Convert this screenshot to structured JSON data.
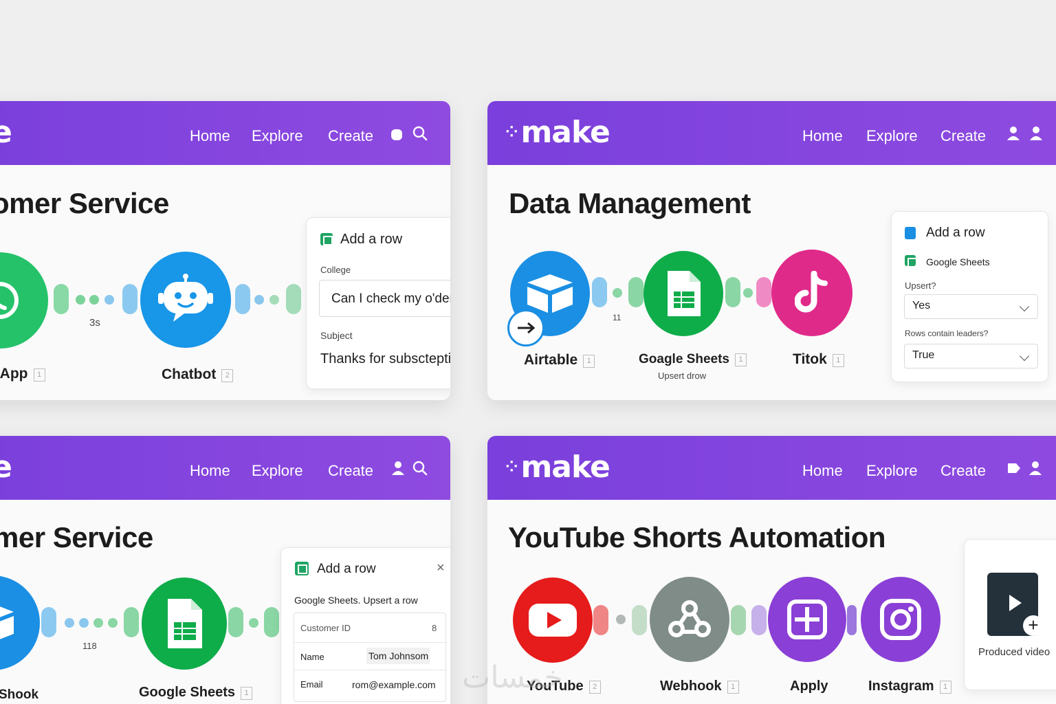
{
  "panel1": {
    "logo": "e",
    "nav": {
      "home": "Home",
      "explore": "Explore",
      "create": "Create"
    },
    "title": "omer Service",
    "nodes": [
      {
        "label": "sApp",
        "index": "1"
      },
      {
        "label": "Chatbot",
        "index": "2"
      }
    ],
    "delay": "3s",
    "card": {
      "title": "Add a row",
      "field1_label": "College",
      "field1_value": "Can  I check my o'der s",
      "field2_label": "Subject",
      "field2_value": "Thanks for subsctepting"
    }
  },
  "panel2": {
    "logo": "make",
    "nav": {
      "home": "Home",
      "explore": "Explore",
      "create": "Create"
    },
    "title": "Data Management",
    "nodes": [
      {
        "label": "Airtable",
        "index": "1"
      },
      {
        "label": "Goagle Sheets",
        "index": "1",
        "sub": "Upsert drow"
      },
      {
        "label": "Titok",
        "index": "1"
      }
    ],
    "connector_count": "11",
    "card": {
      "title": "Add a row",
      "app": "Google Sheets",
      "select1_label": "Upsert?",
      "select1_value": "Yes",
      "select2_label": "Rows contain leaders?",
      "select2_value": "True"
    }
  },
  "panel3": {
    "logo": "e",
    "nav": {
      "home": "Home",
      "explore": "Explore",
      "create": "Create"
    },
    "title": "mer Service",
    "nodes": [
      {
        "label": "Shook",
        "index": ""
      },
      {
        "label": "Google Sheets",
        "index": "1"
      }
    ],
    "connector_count": "118",
    "card": {
      "title": "Add a row",
      "subtitle": "Google Sheets. Upsert a row",
      "rows": [
        {
          "key": "Customer  ID",
          "value": "8"
        },
        {
          "key": "Name",
          "value": "Tom Johnsom"
        },
        {
          "key": "Email",
          "value": "rom@example.com"
        }
      ]
    }
  },
  "panel4": {
    "logo": "make",
    "nav": {
      "home": "Home",
      "explore": "Explore",
      "create": "Create"
    },
    "title": "YouTube Shorts Automation",
    "nodes": [
      {
        "label": "YouTube",
        "index": "2"
      },
      {
        "label": "Webhook",
        "index": "1"
      },
      {
        "label": "Apply",
        "index": ""
      },
      {
        "label": "Instagram",
        "index": "1"
      }
    ],
    "card": {
      "caption": "Produced video"
    }
  },
  "watermark": "خمسات",
  "colors": {
    "nav_purple": "#7a3fdc",
    "whatsapp": "#25c26a",
    "chatbot": "#1896e8",
    "sheets": "#0fac4a",
    "airtable": "#1a8fe3",
    "tiktok": "#e02a8a",
    "youtube": "#e61b1b",
    "webhook": "#7f8c88",
    "apply": "#8a3fd6",
    "instagram": "#8a3fd6"
  }
}
